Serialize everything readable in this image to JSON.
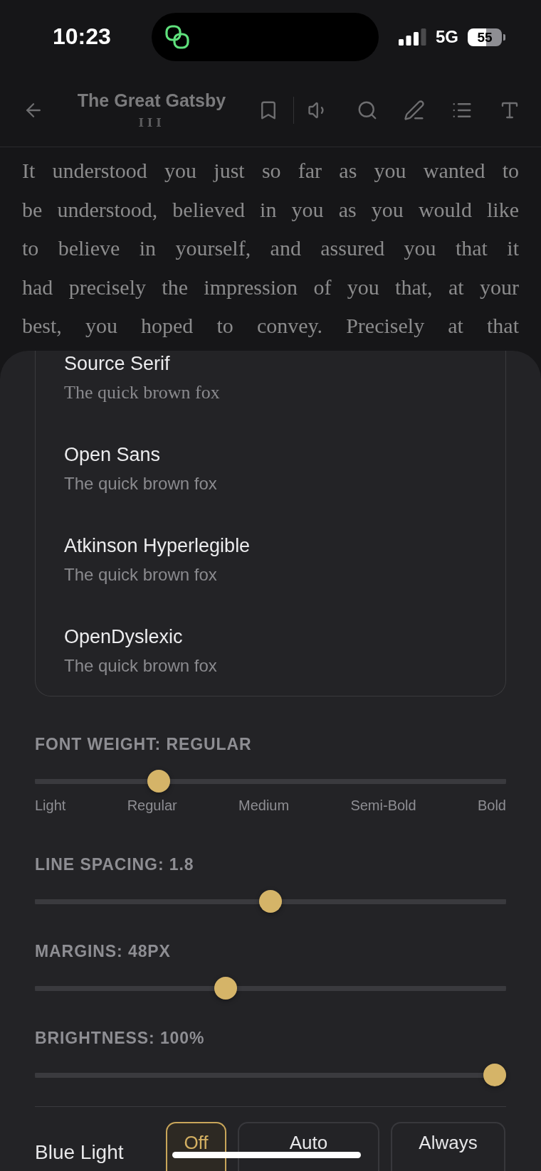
{
  "status_bar": {
    "time": "10:23",
    "network": "5G",
    "battery": "55"
  },
  "toolbar": {
    "title": "The Great Gatsby",
    "chapter": "III"
  },
  "reader": {
    "lines": [
      "It understood you just so far as you wanted to",
      "be understood, believed in you as you would like",
      "to believe in yourself, and assured you that it",
      "had precisely the impression of you that, at your",
      "best, you hoped to convey. Precisely at that"
    ]
  },
  "font_list": {
    "fonts": [
      {
        "name": "Source Serif",
        "sample": "The quick brown fox",
        "kind": "serif"
      },
      {
        "name": "Open Sans",
        "sample": "The quick brown fox",
        "kind": "sans"
      },
      {
        "name": "Atkinson Hyperlegible",
        "sample": "The quick brown fox",
        "kind": "sans"
      },
      {
        "name": "OpenDyslexic",
        "sample": "The quick brown fox",
        "kind": "sans"
      }
    ]
  },
  "sliders": [
    {
      "label": "FONT WEIGHT: REGULAR",
      "level": 0.25,
      "ticks": [
        "Light",
        "Regular",
        "Medium",
        "Semi-Bold",
        "Bold"
      ]
    },
    {
      "label": "LINE SPACING: 1.8",
      "level": 0.5
    },
    {
      "label": "MARGINS: 48PX",
      "level": 0.4
    },
    {
      "label": "BRIGHTNESS: 100%",
      "level": 1
    }
  ],
  "blue_light": {
    "label": "Blue Light",
    "options": [
      {
        "label": "Off",
        "selected": true
      },
      {
        "label": "Auto",
        "selected": false
      },
      {
        "label": "Always",
        "selected": false
      }
    ]
  }
}
